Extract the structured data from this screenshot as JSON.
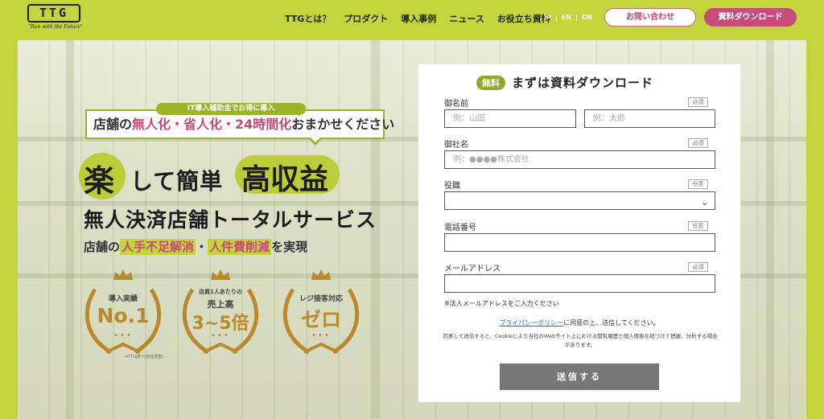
{
  "header": {
    "logo_text": "TTG",
    "logo_tagline": "\"Run with the Future\"",
    "nav": [
      "TTGとは？",
      "プロダクト",
      "導入事例",
      "ニュース",
      "お役立ち資料"
    ],
    "langs": [
      "JP",
      "EN",
      "CN"
    ],
    "contact_label": "お問い合わせ",
    "download_label": "資料ダウンロード"
  },
  "hero": {
    "callout_tag": "IT導入補助金でお得に導入",
    "callout_pre": "店舗の",
    "callout_pink": "無人化・省人化・24時間化",
    "callout_post": "おまかせください",
    "headline_raku": "楽",
    "headline_mid": "して簡単",
    "headline_kou": "高収益",
    "subheadline": "無人決済店舗トータルサービス",
    "line3_pre": "店舗の",
    "line3_hi1": "人手不足解消",
    "line3_mid": "・",
    "line3_hi2": "人件費削減",
    "line3_post": "を実現",
    "awards": [
      {
        "top": "導入実績",
        "main": "No.1"
      },
      {
        "top": "店員1人あたりの",
        "mid": "売上高",
        "main": "3~5倍"
      },
      {
        "top": "レジ接客対応",
        "main": "ゼロ"
      }
    ],
    "award_note": "※TTG調べ(自社調査)"
  },
  "form": {
    "free_badge": "無料",
    "title": "まずは資料ダウンロード",
    "required": "必須",
    "optional": "任意",
    "name_label": "御名前",
    "last_placeholder": "例：山田",
    "first_placeholder": "例：太郎",
    "company_label": "御社名",
    "company_placeholder": "例：●●●●株式会社",
    "role_label": "役職",
    "phone_label": "電話番号",
    "email_label": "メールアドレス",
    "email_note": "※法人メールアドレスをご入力ください",
    "privacy_link": "プライバシーポリシー",
    "privacy_rest": "に同意の上、送信してください。",
    "cookie_text": "同意して送信すると、Cookieにより当社のWebサイト上における閲覧履歴と個人情報を紐づけて把握、分析する場合があります。",
    "submit_label": "送信する"
  },
  "colors": {
    "brand_green": "#c4d43c",
    "accent_pink": "#c74d78",
    "gold": "#b8892d"
  }
}
